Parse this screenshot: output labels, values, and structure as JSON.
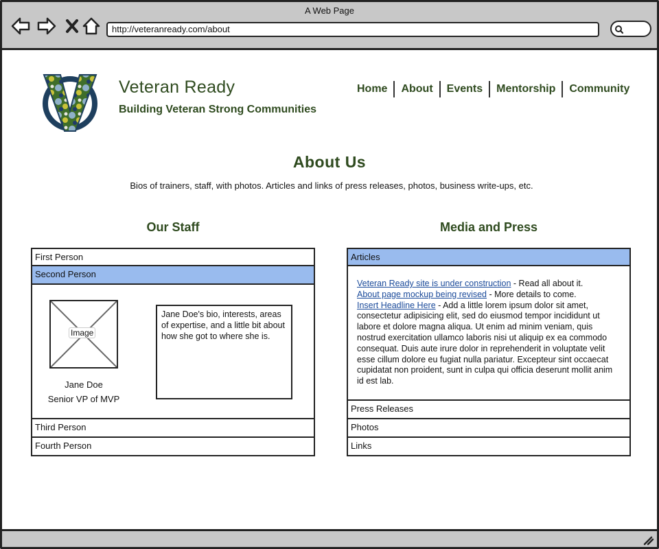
{
  "window": {
    "title": "A Web Page",
    "url": "http://veteranready.com/about"
  },
  "site": {
    "title": "Veteran Ready",
    "tagline": "Building Veteran Strong Communities",
    "logo_letter": "V",
    "nav": [
      "Home",
      "About",
      "Events",
      "Mentorship",
      "Community"
    ]
  },
  "page": {
    "heading": "About Us",
    "intro": "Bios of trainers, staff, with photos.  Articles and links of press releases, photos, business write-ups, etc."
  },
  "staff": {
    "heading": "Our Staff",
    "items": [
      {
        "label": "First Person",
        "selected": false
      },
      {
        "label": "Second Person",
        "selected": true
      },
      {
        "label": "Third Person",
        "selected": false
      },
      {
        "label": "Fourth Person",
        "selected": false
      }
    ],
    "expanded": {
      "image_label": "Image",
      "name": "Jane Doe",
      "role": "Senior VP of MVP",
      "bio": "Jane Doe's bio, interests, areas of expertise, and a little bit about how she got to where she is."
    }
  },
  "media": {
    "heading": "Media and Press",
    "items": [
      {
        "label": "Articles",
        "selected": true
      },
      {
        "label": "Press Releases",
        "selected": false
      },
      {
        "label": "Photos",
        "selected": false
      },
      {
        "label": "Links",
        "selected": false
      }
    ],
    "articles": [
      {
        "link": "Veteran Ready site is under construction",
        "text": " - Read all about it."
      },
      {
        "link": "About page mockup being revised",
        "text": " - More details to come."
      },
      {
        "link": "Insert Headline Here",
        "text": " - Add a little lorem ipsum dolor sit amet, consectetur adipisicing elit, sed do eiusmod tempor incididunt ut labore et dolore magna aliqua. Ut enim ad minim veniam, quis nostrud exercitation ullamco laboris nisi ut aliquip ex ea commodo consequat. Duis aute irure dolor in reprehenderit in voluptate velit esse cillum dolore eu fugiat nulla pariatur. Excepteur sint occaecat cupidatat non proident, sunt in culpa qui officia deserunt mollit anim id est lab."
      }
    ]
  },
  "colors": {
    "brand_green": "#2e4a1e",
    "selected_row": "#99bbee",
    "chrome_gray": "#c8c8c8",
    "link_blue": "#1a4a9a"
  },
  "icons": [
    "back-arrow-icon",
    "forward-arrow-icon",
    "close-icon",
    "home-icon",
    "search-icon",
    "resize-grip-icon"
  ]
}
